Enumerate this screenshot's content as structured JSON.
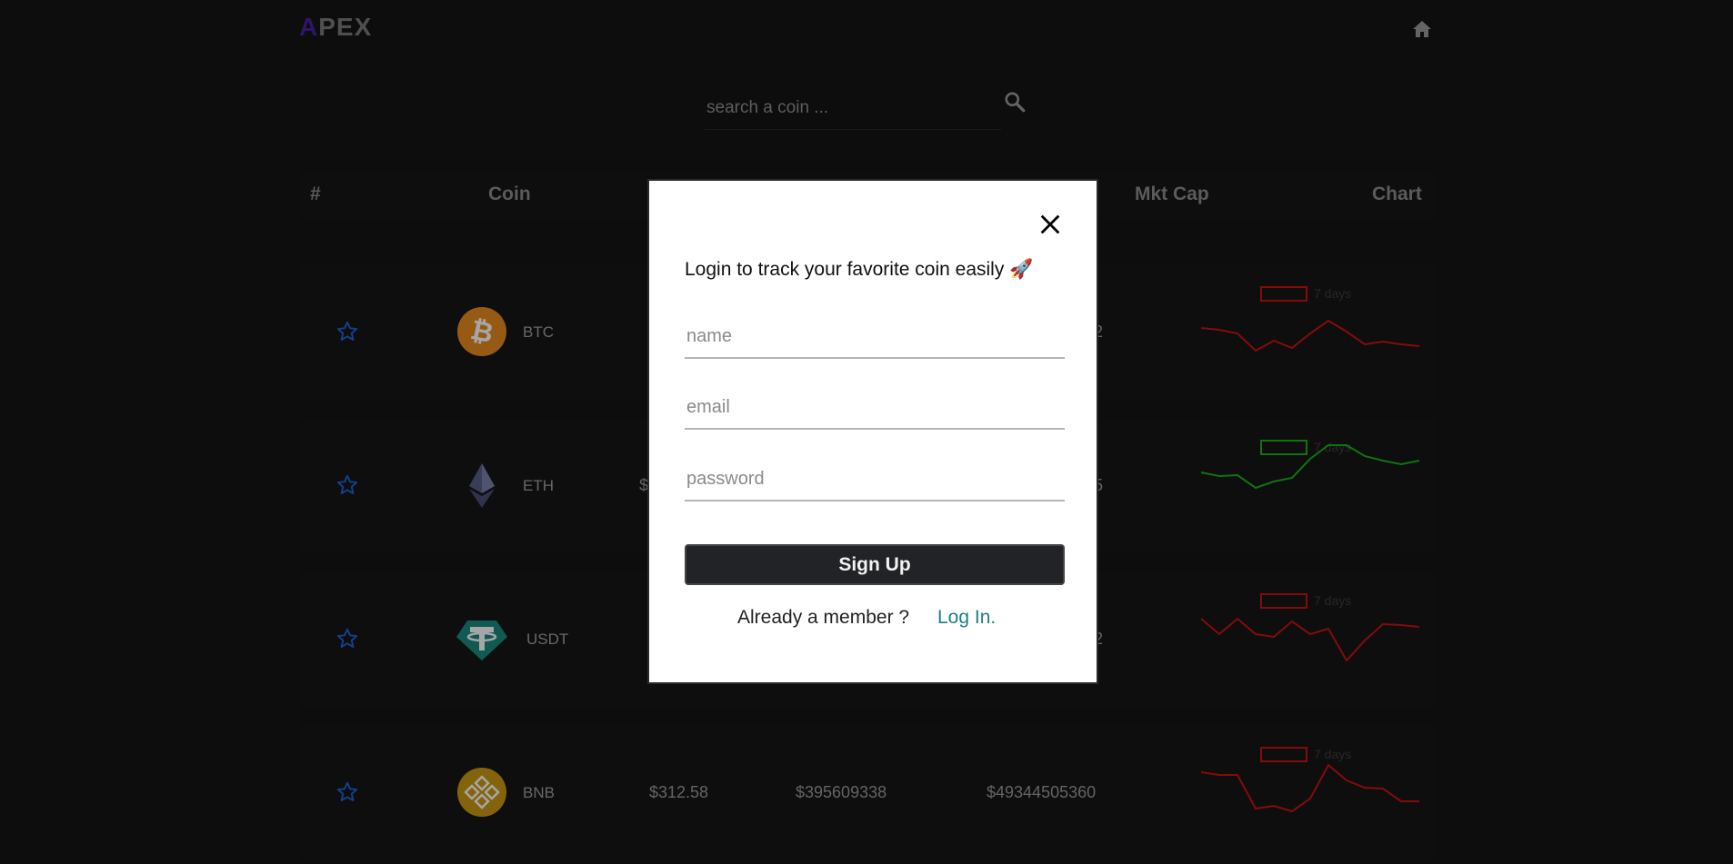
{
  "header": {
    "logo_first": "A",
    "logo_rest": "PEX"
  },
  "search": {
    "placeholder": "search a coin ..."
  },
  "table": {
    "headers": {
      "rank": "#",
      "coin": "Coin",
      "mkt_cap": "Mkt Cap",
      "chart": "Chart"
    },
    "legend_label": "7 days",
    "rows": [
      {
        "symbol": "BTC",
        "mkt_cap_partial": "2",
        "trend": "down",
        "color": "#cc1111",
        "sparkline": [
          70,
          72,
          76,
          95,
          84,
          92,
          76,
          62,
          74,
          88,
          85,
          88,
          90
        ]
      },
      {
        "symbol": "ETH",
        "price_partial": "$",
        "mkt_cap_partial": "5",
        "trend": "up",
        "color": "#18b318",
        "sparkline": [
          60,
          64,
          63,
          77,
          70,
          66,
          45,
          30,
          30,
          42,
          47,
          51,
          47
        ]
      },
      {
        "symbol": "USDT",
        "mkt_cap_partial": "2",
        "trend": "down",
        "color": "#cc1111",
        "sparkline": [
          52,
          69,
          52,
          69,
          72,
          55,
          69,
          63,
          98,
          76,
          58,
          59,
          61
        ]
      },
      {
        "symbol": "BNB",
        "price": "$312.58",
        "volume": "$395609338",
        "mkt_cap": "$49344505360",
        "trend": "down",
        "color": "#cc1111",
        "sparkline": [
          52,
          55,
          55,
          92,
          89,
          95,
          81,
          44,
          61,
          69,
          70,
          84,
          84
        ]
      }
    ]
  },
  "modal": {
    "title": "Login to track your favorite coin easily 🚀",
    "name_placeholder": "name",
    "email_placeholder": "email",
    "password_placeholder": "password",
    "signup_label": "Sign Up",
    "member_text": "Already a member ?",
    "login_link": "Log In."
  },
  "icons": {
    "home": "home-icon",
    "search": "search-icon",
    "close": "close-icon",
    "star": "star-outline-icon"
  },
  "colors": {
    "accent_logo": "#4b1fa3",
    "star": "#1e63d6",
    "link": "#1a7f86",
    "down": "#cc1111",
    "up": "#18b318"
  }
}
